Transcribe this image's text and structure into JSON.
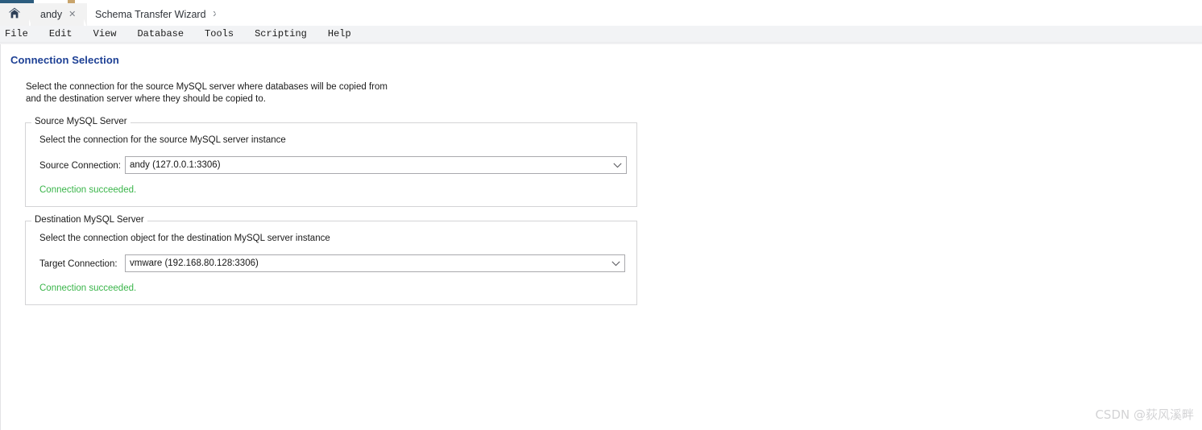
{
  "window": {
    "tabs": [
      {
        "name": "home-tab",
        "icon": "home-icon",
        "label": "",
        "close": ""
      },
      {
        "name": "andy-tab",
        "icon": "",
        "label": "andy",
        "close": "✕"
      },
      {
        "name": "schema-transfer-wizard-tab",
        "icon": "",
        "label": "Schema Transfer Wizard",
        "close": "✕"
      }
    ]
  },
  "menu": {
    "items": [
      {
        "label": "File"
      },
      {
        "label": "Edit"
      },
      {
        "label": "View"
      },
      {
        "label": "Database"
      },
      {
        "label": "Tools"
      },
      {
        "label": "Scripting"
      },
      {
        "label": "Help"
      }
    ]
  },
  "page": {
    "title": "Connection Selection",
    "description": "Select the connection for the source MySQL server where databases will be copied from\nand the destination server where they should be copied to."
  },
  "source_group": {
    "legend": "Source MySQL Server",
    "hint": "Select the connection for the source MySQL server instance",
    "field_label": "Source Connection:",
    "connection_value": "andy (127.0.0.1:3306)",
    "status": "Connection succeeded.",
    "status_color": "#3ab54a",
    "dropdown_arrow": "⌄"
  },
  "destination_group": {
    "legend": "Destination MySQL Server",
    "hint": "Select the connection object for the destination MySQL server instance",
    "field_label": "Target Connection:",
    "connection_value": "vmware (192.168.80.128:3306)",
    "status": "Connection succeeded.",
    "status_color": "#3ab54a",
    "dropdown_arrow": "⌄"
  },
  "watermark": {
    "text": "CSDN @荻风溪畔"
  },
  "colors": {
    "title_blue": "#1c3f94",
    "status_green": "#3ab54a",
    "menubar_bg": "#f2f3f5",
    "tab_inactive_bg": "#f2f2f2",
    "tab_active_bg": "#ffffff"
  }
}
